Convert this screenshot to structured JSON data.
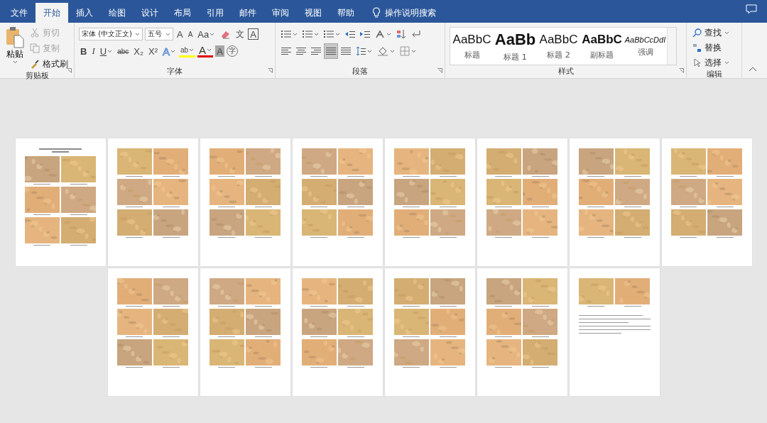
{
  "tabs": [
    {
      "label": "文件",
      "selected": false
    },
    {
      "label": "开始",
      "selected": true
    },
    {
      "label": "插入",
      "selected": false
    },
    {
      "label": "绘图",
      "selected": false
    },
    {
      "label": "设计",
      "selected": false
    },
    {
      "label": "布局",
      "selected": false
    },
    {
      "label": "引用",
      "selected": false
    },
    {
      "label": "邮件",
      "selected": false
    },
    {
      "label": "审阅",
      "selected": false
    },
    {
      "label": "视图",
      "selected": false
    },
    {
      "label": "帮助",
      "selected": false
    }
  ],
  "tell_me": {
    "placeholder": "操作说明搜索"
  },
  "clipboard": {
    "title": "剪贴板",
    "paste": "粘贴",
    "items": [
      {
        "label": "剪切",
        "disabled": true
      },
      {
        "label": "复制",
        "disabled": true
      },
      {
        "label": "格式刷",
        "disabled": false
      }
    ]
  },
  "font": {
    "title": "字体",
    "font_name": "宋体 (中文正文)",
    "font_size": "五号",
    "row1": [
      {
        "kind": "grow",
        "glyph": "A"
      },
      {
        "kind": "shrink",
        "glyph": "A"
      },
      {
        "kind": "case",
        "glyph": "Aa"
      },
      {
        "kind": "clear"
      },
      {
        "kind": "phonetic",
        "glyph": "文"
      },
      {
        "kind": "border",
        "glyph": "A"
      }
    ],
    "row2": [
      {
        "kind": "bold",
        "glyph": "B"
      },
      {
        "kind": "italic",
        "glyph": "I"
      },
      {
        "kind": "underline",
        "glyph": "U"
      },
      {
        "kind": "strike",
        "glyph": "abc"
      },
      {
        "kind": "sub",
        "glyph": "X₂"
      },
      {
        "kind": "sup",
        "glyph": "X²"
      },
      {
        "kind": "effects",
        "glyph": "A"
      },
      {
        "kind": "highlight",
        "glyph": "ab"
      },
      {
        "kind": "color",
        "glyph": "A"
      },
      {
        "kind": "shading",
        "glyph": "A"
      },
      {
        "kind": "enclose",
        "glyph": "字"
      }
    ]
  },
  "paragraph": {
    "title": "段落",
    "alignment": [
      {
        "selected": false
      },
      {
        "selected": false
      },
      {
        "selected": false
      },
      {
        "selected": true
      },
      {
        "selected": false
      }
    ]
  },
  "styles": {
    "title": "样式",
    "items": [
      {
        "sample": "AaBbC",
        "label": "标题",
        "kind": "plain"
      },
      {
        "sample": "AaBb",
        "label": "标题 1",
        "kind": "heavy"
      },
      {
        "sample": "AaBbC",
        "label": "标题 2",
        "kind": "plain"
      },
      {
        "sample": "AaBbC",
        "label": "副标题",
        "kind": "bold"
      },
      {
        "sample": "AaBbCcDdI",
        "label": "强调",
        "kind": "italic"
      }
    ]
  },
  "editing": {
    "title": "编辑",
    "items": [
      {
        "label": "查找",
        "kind": "find"
      },
      {
        "label": "替换",
        "kind": "replace"
      },
      {
        "label": "选择",
        "kind": "select"
      }
    ]
  },
  "pages": [
    {
      "kind": "title-page"
    },
    {
      "kind": "photos"
    },
    {
      "kind": "photos"
    },
    {
      "kind": "photos"
    },
    {
      "kind": "photos"
    },
    {
      "kind": "photos"
    },
    {
      "kind": "photos"
    },
    {
      "kind": "photos"
    },
    {
      "kind": "photos"
    },
    {
      "kind": "photos"
    },
    {
      "kind": "photos"
    },
    {
      "kind": "photos"
    },
    {
      "kind": "photos"
    },
    {
      "kind": "closing"
    }
  ]
}
